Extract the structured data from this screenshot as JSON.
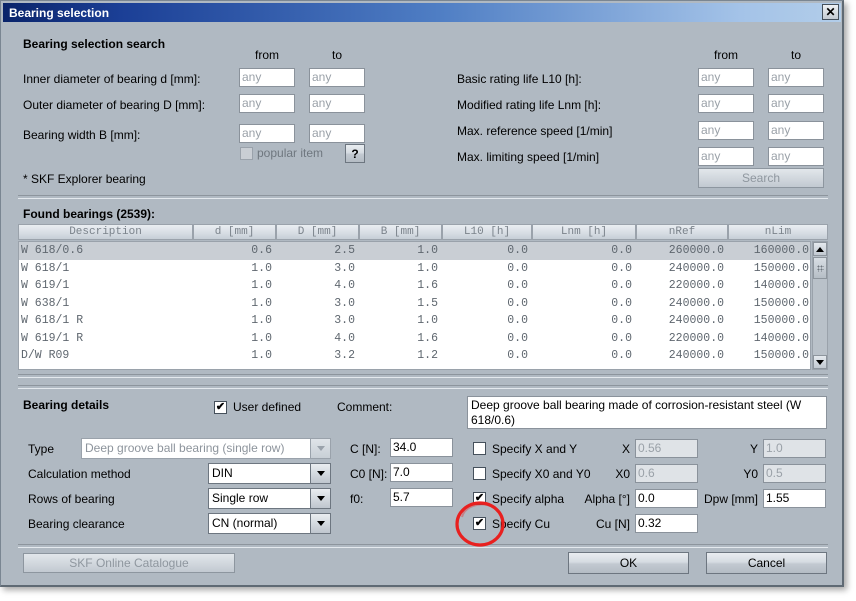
{
  "window": {
    "title": "Bearing selection",
    "close_icon": "close-icon"
  },
  "search": {
    "heading": "Bearing selection search",
    "from_label": "from",
    "to_label": "to",
    "left_rows": [
      {
        "label": "Inner diameter of bearing d [mm]:",
        "from": "any",
        "to": "any"
      },
      {
        "label": "Outer diameter of bearing D [mm]:",
        "from": "any",
        "to": "any"
      },
      {
        "label": "Bearing width B [mm]:",
        "from": "any",
        "to": "any"
      }
    ],
    "right_rows": [
      {
        "label": "Basic rating life L10 [h]:",
        "from": "any",
        "to": "any"
      },
      {
        "label": "Modified rating life Lnm [h]:",
        "from": "any",
        "to": "any"
      },
      {
        "label": "Max. reference speed [1/min]",
        "from": "any",
        "to": "any"
      },
      {
        "label": "Max. limiting speed [1/min]",
        "from": "any",
        "to": "any"
      }
    ],
    "popular_item_label": "popular item",
    "popular_item_checked": "",
    "help_label": "?",
    "search_button": "Search",
    "footnote": "* SKF Explorer bearing"
  },
  "found": {
    "heading": "Found bearings (2539):",
    "columns": [
      "Description",
      "d [mm]",
      "D [mm]",
      "B [mm]",
      "L10 [h]",
      "Lnm [h]",
      "nRef",
      "nLim"
    ],
    "rows": [
      {
        "desc": "W 618/0.6",
        "d": "0.6",
        "D": "2.5",
        "B": "1.0",
        "L10": "0.0",
        "Lnm": "0.0",
        "nRef": "260000.0",
        "nLim": "160000.0",
        "selected": true
      },
      {
        "desc": "W 618/1",
        "d": "1.0",
        "D": "3.0",
        "B": "1.0",
        "L10": "0.0",
        "Lnm": "0.0",
        "nRef": "240000.0",
        "nLim": "150000.0",
        "selected": false
      },
      {
        "desc": "W 619/1",
        "d": "1.0",
        "D": "4.0",
        "B": "1.6",
        "L10": "0.0",
        "Lnm": "0.0",
        "nRef": "220000.0",
        "nLim": "140000.0",
        "selected": false
      },
      {
        "desc": "W 638/1",
        "d": "1.0",
        "D": "3.0",
        "B": "1.5",
        "L10": "0.0",
        "Lnm": "0.0",
        "nRef": "240000.0",
        "nLim": "150000.0",
        "selected": false
      },
      {
        "desc": "W 618/1 R",
        "d": "1.0",
        "D": "3.0",
        "B": "1.0",
        "L10": "0.0",
        "Lnm": "0.0",
        "nRef": "240000.0",
        "nLim": "150000.0",
        "selected": false
      },
      {
        "desc": "W 619/1 R",
        "d": "1.0",
        "D": "4.0",
        "B": "1.6",
        "L10": "0.0",
        "Lnm": "0.0",
        "nRef": "220000.0",
        "nLim": "140000.0",
        "selected": false
      },
      {
        "desc": "D/W R09",
        "d": "1.0",
        "D": "3.2",
        "B": "1.2",
        "L10": "0.0",
        "Lnm": "0.0",
        "nRef": "240000.0",
        "nLim": "150000.0",
        "selected": false
      }
    ],
    "scroll_up_icon": "triangle-up-icon",
    "scroll_down_icon": "triangle-down-icon"
  },
  "details": {
    "heading": "Bearing details",
    "user_defined_label": "User defined",
    "user_defined_checked": "✔",
    "comment_label": "Comment:",
    "comment_value": "Deep groove ball bearing made of corrosion-resistant steel (W 618/0.6)",
    "type_label": "Type",
    "type_value": "Deep groove ball bearing (single row)",
    "calc_label": "Calculation method",
    "calc_value": "DIN",
    "rows_label": "Rows of bearing",
    "rows_value": "Single row",
    "clearance_label": "Bearing clearance",
    "clearance_value": "CN (normal)",
    "c_label": "C [N]:",
    "c_value": "34.0",
    "c0_label": "C0 [N]:",
    "c0_value": "7.0",
    "f0_label": "f0:",
    "f0_value": "5.7",
    "specify_xy_label": "Specify X and Y",
    "specify_xy_checked": "",
    "x_label": "X",
    "x_value": "0.56",
    "y_label": "Y",
    "y_value": "1.0",
    "specify_x0y0_label": "Specify X0 and Y0",
    "specify_x0y0_checked": "",
    "x0_label": "X0",
    "x0_value": "0.6",
    "y0_label": "Y0",
    "y0_value": "0.5",
    "specify_alpha_label": "Specify alpha",
    "specify_alpha_checked": "✔",
    "alpha_label": "Alpha [°]",
    "alpha_value": "0.0",
    "dpw_label": "Dpw [mm]",
    "dpw_value": "1.55",
    "specify_cu_label": "Specify Cu",
    "specify_cu_checked": "✔",
    "cu_label": "Cu [N]",
    "cu_value": "0.32"
  },
  "footer": {
    "catalogue_button": "SKF Online Catalogue",
    "ok_button": "OK",
    "cancel_button": "Cancel"
  },
  "annotation": {
    "shape": "red-ellipse-highlight",
    "color": "#e8201f"
  }
}
